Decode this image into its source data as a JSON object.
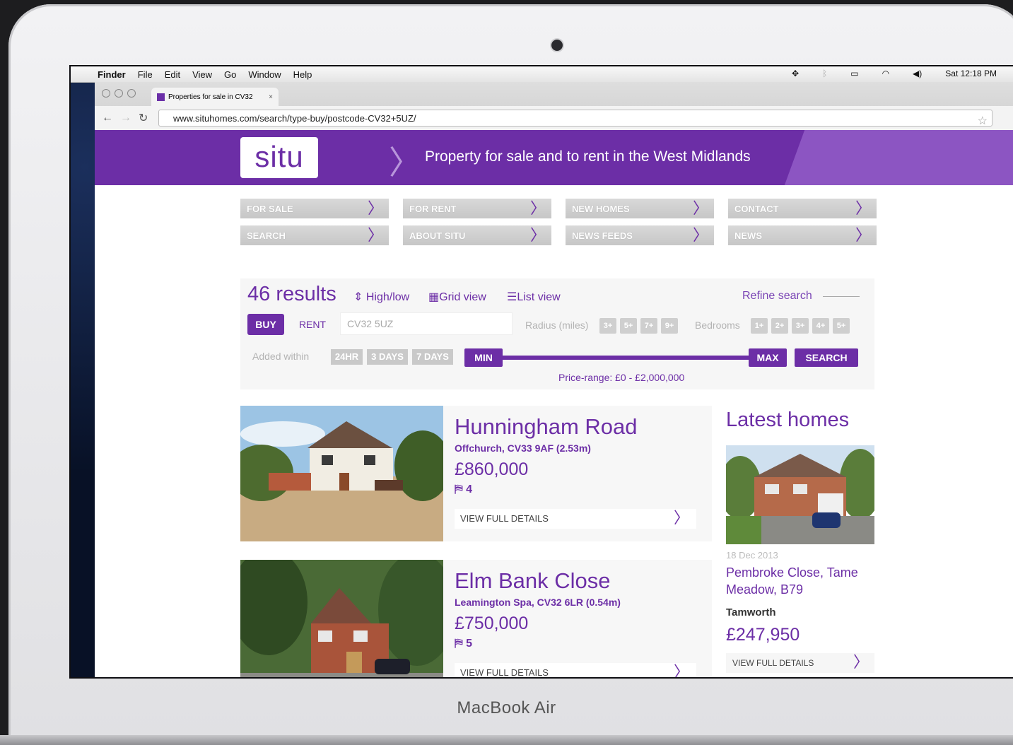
{
  "device": {
    "brand": "MacBook Air"
  },
  "menubar": {
    "apple": "",
    "items": [
      "Finder",
      "File",
      "Edit",
      "View",
      "Go",
      "Window",
      "Help"
    ],
    "clock": "Sat 12:18 PM"
  },
  "browser": {
    "tab_title": "Properties for sale in CV32",
    "url": "www.situhomes.com/search/type-buy/postcode-CV32+5UZ/"
  },
  "site": {
    "logo": "situ",
    "tagline": "Property for sale and to rent in the West Midlands",
    "brand_color": "#6c2ea6",
    "nav": [
      {
        "label": "FOR SALE"
      },
      {
        "label": "FOR RENT"
      },
      {
        "label": "NEW HOMES"
      },
      {
        "label": "CONTACT"
      },
      {
        "label": "SEARCH"
      },
      {
        "label": "ABOUT SITU"
      },
      {
        "label": "NEWS FEEDS"
      },
      {
        "label": "NEWS"
      }
    ]
  },
  "search": {
    "results": "46 results",
    "sort": "High/low",
    "grid_view": "Grid view",
    "list_view": "List view",
    "refine": "Refine search",
    "buy": "BUY",
    "rent": "RENT",
    "postcode": "CV32 5UZ",
    "radius_label": "Radius (miles)",
    "radius_options": [
      "3+",
      "5+",
      "7+",
      "9+"
    ],
    "bedrooms_label": "Bedrooms",
    "bedroom_options": [
      "1+",
      "2+",
      "3+",
      "4+",
      "5+"
    ],
    "added_label": "Added within",
    "added_options": [
      "24HR",
      "3 DAYS",
      "7 DAYS"
    ],
    "min": "MIN",
    "max": "MAX",
    "search_button": "SEARCH",
    "price_range": "Price-range: £0 - £2,000,000"
  },
  "listings": [
    {
      "title": "Hunningham Road",
      "location": "Offchurch, CV33 9AF (2.53m)",
      "price": "£860,000",
      "beds": "4",
      "cta": "VIEW FULL DETAILS"
    },
    {
      "title": "Elm Bank Close",
      "location": "Leamington Spa, CV32 6LR (0.54m)",
      "price": "£750,000",
      "beds": "5",
      "cta": "VIEW FULL DETAILS"
    }
  ],
  "latest": {
    "heading": "Latest homes",
    "date": "18 Dec 2013",
    "name": "Pembroke Close, Tame Meadow, B79",
    "town": "Tamworth",
    "price": "£247,950",
    "cta": "VIEW FULL DETAILS"
  }
}
